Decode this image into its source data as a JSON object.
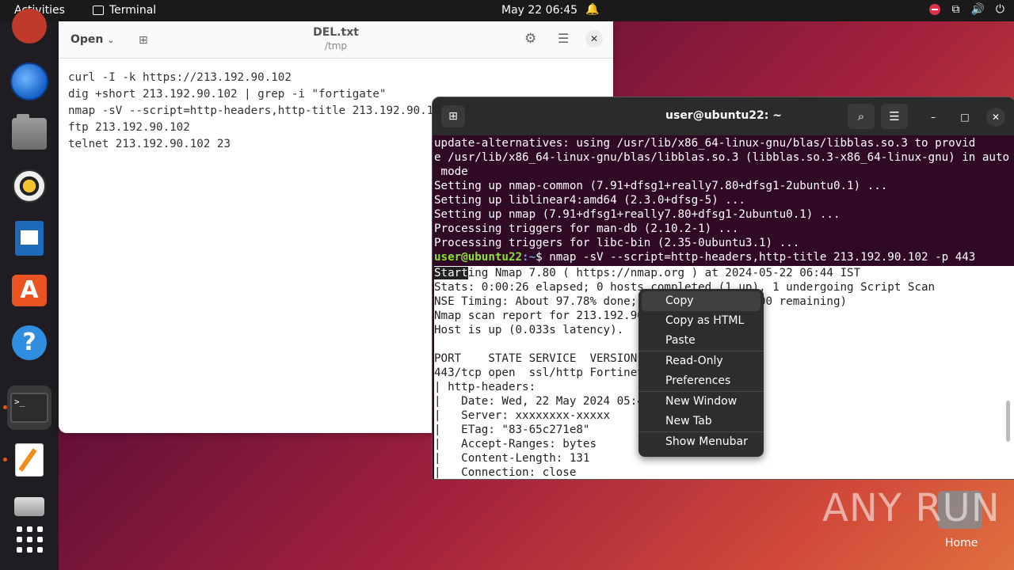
{
  "topbar": {
    "activities": "Activities",
    "app_name": "Terminal",
    "clock": "May 22  06:45"
  },
  "dock": {
    "items": [
      "firefox",
      "thunderbird",
      "files",
      "rhythmbox",
      "libreoffice-writer",
      "app-center",
      "help",
      "terminal",
      "text-editor",
      "removable-drive",
      "show-apps"
    ]
  },
  "gedit": {
    "open_label": "Open",
    "title": "DEL.txt",
    "subtitle": "/tmp",
    "lines": [
      "curl -I -k https://213.192.90.102",
      "dig +short 213.192.90.102 | grep -i \"fortigate\"",
      "nmap -sV --script=http-headers,http-title 213.192.90.102",
      "ftp 213.192.90.102",
      "telnet 213.192.90.102 23"
    ]
  },
  "terminal": {
    "title": "user@ubuntu22: ~",
    "dark_lines": [
      "update-alternatives: using /usr/lib/x86_64-linux-gnu/blas/libblas.so.3 to provid",
      "e /usr/lib/x86_64-linux-gnu/blas/libblas.so.3 (libblas.so.3-x86_64-linux-gnu) in auto",
      " mode",
      "Setting up nmap-common (7.91+dfsg1+really7.80+dfsg1-2ubuntu0.1) ...",
      "Setting up liblinear4:amd64 (2.3.0+dfsg-5) ...",
      "Setting up nmap (7.91+dfsg1+really7.80+dfsg1-2ubuntu0.1) ...",
      "Processing triggers for man-db (2.10.2-1) ...",
      "Processing triggers for libc-bin (2.35-0ubuntu3.1) ..."
    ],
    "prompt_user": "user@ubuntu22",
    "prompt_path": ":~",
    "command": "$ nmap -sV --script=http-headers,http-title 213.192.90.102 -p 443",
    "selected_text": "Start",
    "first_output_rest": "ing Nmap 7.80 ( https://nmap.org ) at 2024-05-22 06:44 IST",
    "output_lines": [
      "Stats: 0:00:26 elapsed; 0 hosts completed (1 up), 1 undergoing Script Scan",
      "NSE Timing: About 97.78% done; ETC: 06:45 (0:00:00 remaining)",
      "Nmap scan report for 213.192.90.102",
      "Host is up (0.033s latency).",
      "",
      "PORT    STATE SERVICE  VERSION",
      "443/tcp open  ssl/http Fortinet SSL VPN httpd",
      "| http-headers:",
      "|   Date: Wed, 22 May 2024 05:45:23 GMT",
      "|   Server: xxxxxxxx-xxxxx",
      "|   ETag: \"83-65c271e8\"",
      "|   Accept-Ranges: bytes",
      "|   Content-Length: 131",
      "|   Connection: close"
    ]
  },
  "context_menu": {
    "copy": "Copy",
    "copy_html": "Copy as HTML",
    "paste": "Paste",
    "read_only": "Read-Only",
    "preferences": "Preferences",
    "new_window": "New Window",
    "new_tab": "New Tab",
    "show_menubar": "Show Menubar"
  },
  "desktop": {
    "watermark": "ANY RUN",
    "home_label": "Home"
  },
  "colors": {
    "terminal_bg": "#300a24",
    "prompt_user": "#8ae234",
    "prompt_path": "#729fcf",
    "accent": "#e95420"
  }
}
